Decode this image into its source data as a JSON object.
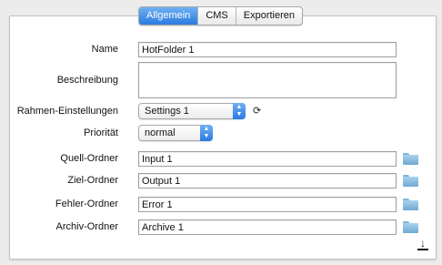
{
  "tabs": [
    {
      "label": "Allgemein",
      "active": true
    },
    {
      "label": "CMS",
      "active": false
    },
    {
      "label": "Exportieren",
      "active": false
    }
  ],
  "form": {
    "name": {
      "label": "Name",
      "value": "HotFolder 1"
    },
    "description": {
      "label": "Beschreibung",
      "value": ""
    },
    "frame_settings": {
      "label": "Rahmen-Einstellungen",
      "value": "Settings 1"
    },
    "priority": {
      "label": "Priorität",
      "value": "normal"
    },
    "source_folder": {
      "label": "Quell-Ordner",
      "value": "Input 1"
    },
    "target_folder": {
      "label": "Ziel-Ordner",
      "value": "Output 1"
    },
    "error_folder": {
      "label": "Fehler-Ordner",
      "value": "Error 1"
    },
    "archive_folder": {
      "label": "Archiv-Ordner",
      "value": "Archive 1"
    }
  },
  "icons": {
    "folder": "folder-icon",
    "sync": "sync-icon",
    "download": "download-icon"
  },
  "colors": {
    "accent": "#2a7be0",
    "folder": "#8cc2e4"
  }
}
